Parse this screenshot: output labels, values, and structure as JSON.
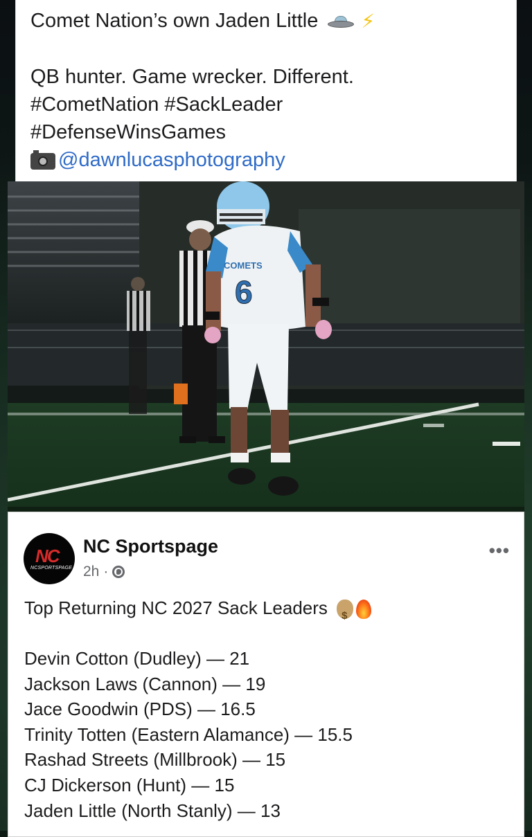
{
  "caption": {
    "line1": "Comet Nation’s own Jaden Little",
    "line2": "QB hunter. Game wrecker. Different.",
    "hashtags_line1": "#CometNation #SackLeader",
    "hashtags_line2": "#DefenseWinsGames",
    "photo_credit": "@dawnlucasphotography",
    "icons": [
      "ufo-emoji",
      "lightning-emoji",
      "camera-emoji"
    ]
  },
  "photo": {
    "jersey_text": "COMETS",
    "jersey_number": "6",
    "accent_color": "#6fb8e6"
  },
  "post": {
    "page_name": "NC Sportspage",
    "avatar_text": "NC",
    "avatar_subtext": "NCSPORTSPAGE",
    "time": "2h",
    "separator": "·",
    "more_label": "•••",
    "headline": "Top Returning NC 2027 Sack Leaders",
    "leaders": [
      "Devin Cotton (Dudley) — 21",
      "Jackson Laws (Cannon) — 19",
      "Jace Goodwin (PDS) — 16.5",
      "Trinity Totten (Eastern Alamance) — 15.5",
      "Rashad Streets (Millbrook) — 15",
      "CJ Dickerson (Hunt) — 15",
      "Jaden Little (North Stanly) — 13"
    ]
  }
}
